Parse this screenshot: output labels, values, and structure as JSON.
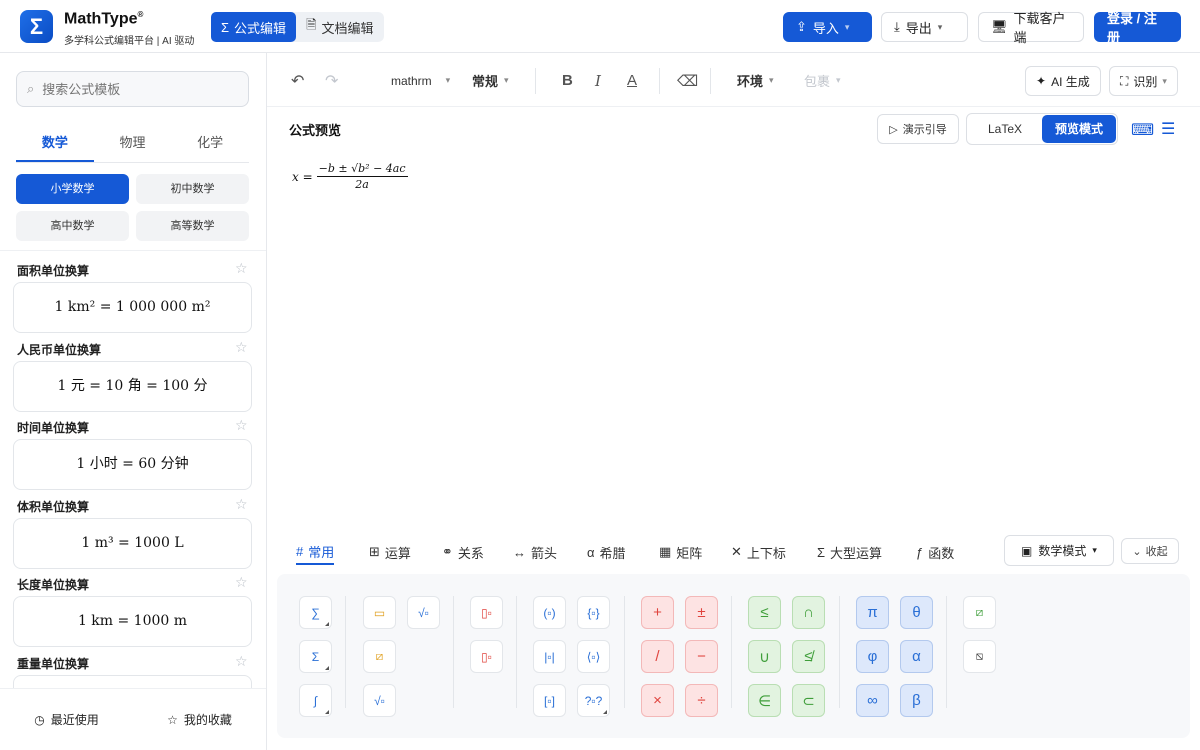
{
  "header": {
    "logo_glyph": "Σ",
    "brand": "MathType",
    "brand_mark": "®",
    "subtitle": "多学科公式编辑平台 | AI 驱动",
    "mode_tabs": [
      {
        "label": "公式编辑",
        "icon": "sigma-icon",
        "active": true
      },
      {
        "label": "文档编辑",
        "icon": "document-icon",
        "active": false
      }
    ],
    "import_label": "导入",
    "export_label": "导出",
    "download_label": "下载客户端",
    "login_label": "登录 / 注册",
    "accent_color": "#1559d6"
  },
  "sidebar": {
    "search_placeholder": "搜索公式模板",
    "subject_tabs": [
      {
        "label": "数学",
        "active": true
      },
      {
        "label": "物理",
        "active": false
      },
      {
        "label": "化学",
        "active": false
      }
    ],
    "grades": [
      {
        "label": "小学数学",
        "active": true
      },
      {
        "label": "初中数学",
        "active": false
      },
      {
        "label": "高中数学",
        "active": false
      },
      {
        "label": "高等数学",
        "active": false
      }
    ],
    "templates": [
      {
        "title": "面积单位换算",
        "formula": "1 km² = 1 000 000 m²"
      },
      {
        "title": "人民币单位换算",
        "formula": "1 元 = 10 角 = 100 分"
      },
      {
        "title": "时间单位换算",
        "formula": "1 小时 = 60 分钟"
      },
      {
        "title": "体积单位换算",
        "formula": "1 m³ = 1000 L"
      },
      {
        "title": "长度单位换算",
        "formula": "1 km = 1000 m"
      },
      {
        "title": "重量单位换算",
        "formula": ""
      }
    ],
    "footer": {
      "recent_label": "最近使用",
      "favorites_label": "我的收藏"
    }
  },
  "toolbar": {
    "font_name": "mathrm",
    "font_style": "常规",
    "environment": "环境",
    "wrap": "包裹",
    "ai_generate": "AI 生成",
    "recognize": "识别"
  },
  "preview": {
    "title": "公式预览",
    "demo_label": "演示引导",
    "view_modes": [
      {
        "label": "LaTeX",
        "active": false
      },
      {
        "label": "预览模式",
        "active": true
      }
    ],
    "formula": {
      "lhs": "x =",
      "numerator": "−b ± √b² − 4ac",
      "denominator": "2a"
    }
  },
  "symbol_tabs": [
    {
      "label": "常用",
      "icon": "#",
      "active": true
    },
    {
      "label": "运算",
      "icon": "⊞",
      "active": false
    },
    {
      "label": "关系",
      "icon": "⚭",
      "active": false
    },
    {
      "label": "箭头",
      "icon": "↔",
      "active": false
    },
    {
      "label": "希腊",
      "icon": "α",
      "active": false
    },
    {
      "label": "矩阵",
      "icon": "▦",
      "active": false
    },
    {
      "label": "上下标",
      "icon": "✕",
      "active": false
    },
    {
      "label": "大型运算",
      "icon": "Σ",
      "active": false
    },
    {
      "label": "函数",
      "icon": "ƒ",
      "active": false
    }
  ],
  "symbol_panel": {
    "math_mode": "数学模式",
    "collapse": "收起",
    "operators": [
      "+",
      "±",
      "/",
      "−",
      "×",
      "÷"
    ],
    "relations": [
      "≤",
      "∩",
      "∪",
      "≰",
      "∈",
      "⊂"
    ],
    "greek": [
      "π",
      "θ",
      "φ",
      "α",
      "∞",
      "β"
    ]
  }
}
